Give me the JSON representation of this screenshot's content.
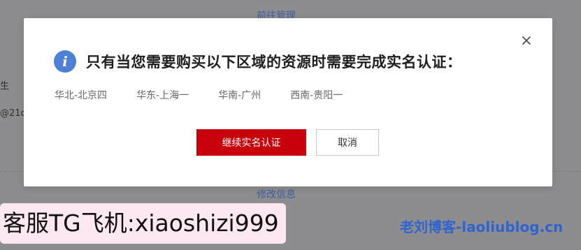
{
  "background": {
    "manage_link": "前往管理",
    "modify_link": "修改信息",
    "left_text_1": "生",
    "left_text_2": "@21c"
  },
  "dialog": {
    "title": "只有当您需要购买以下区域的资源时需要完成实名认证：",
    "info_icon_glyph": "i",
    "close_glyph": "×",
    "regions": [
      "华北-北京四",
      "华东-上海一",
      "华南-广州",
      "西南-贵阳一"
    ],
    "primary_button": "继续实名认证",
    "secondary_button": "取消"
  },
  "watermarks": {
    "left": "客服TG飞机:xiaoshizi999",
    "right": "老刘博客-laoliublog.cn"
  },
  "colors": {
    "primary": "#c7000b",
    "info_icon": "#4d7fd6",
    "link": "#3f5f9a",
    "watermark_link": "#2f63d0"
  }
}
